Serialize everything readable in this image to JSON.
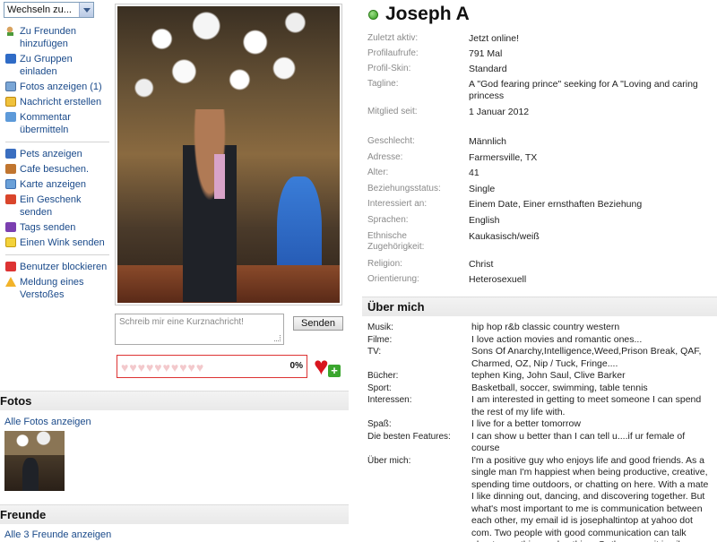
{
  "nav": {
    "select_value": "Wechseln zu..."
  },
  "actions": [
    {
      "label": "Zu Freunden hinzufügen",
      "icon": "add-friend-icon"
    },
    {
      "label": "Zu Gruppen einladen",
      "icon": "group-icon"
    },
    {
      "label": "Fotos anzeigen (1)",
      "icon": "photo-icon"
    },
    {
      "label": "Nachricht erstellen",
      "icon": "mail-icon"
    },
    {
      "label": "Kommentar übermitteln",
      "icon": "comment-icon"
    }
  ],
  "actions2": [
    {
      "label": "Pets anzeigen",
      "icon": "pets-icon"
    },
    {
      "label": "Cafe besuchen.",
      "icon": "cafe-icon"
    },
    {
      "label": "Karte anzeigen",
      "icon": "map-icon"
    },
    {
      "label": "Ein Geschenk senden",
      "icon": "gift-icon"
    },
    {
      "label": "Tags senden",
      "icon": "tag-icon"
    },
    {
      "label": "Einen Wink senden",
      "icon": "wink-icon"
    }
  ],
  "actions3": [
    {
      "label": "Benutzer blockieren",
      "icon": "block-icon"
    },
    {
      "label": "Meldung eines Verstoßes",
      "icon": "warning-icon"
    }
  ],
  "message": {
    "placeholder": "Schreib mir eine Kurznachricht!",
    "send_label": "Senden"
  },
  "hearts": {
    "percent": "0%",
    "glyphs": "♥♥♥♥♥♥♥♥♥♥"
  },
  "fotos": {
    "title": "Fotos",
    "link": "Alle Fotos anzeigen"
  },
  "freunde": {
    "title": "Freunde",
    "link": "Alle 3 Freunde anzeigen"
  },
  "profile": {
    "name": "Joseph A",
    "status_color": "#2e9a1a",
    "details": [
      {
        "k": "Zuletzt aktiv:",
        "v": "Jetzt online!"
      },
      {
        "k": "Profilaufrufe:",
        "v": "791 Mal"
      },
      {
        "k": "Profil-Skin:",
        "v": "Standard"
      },
      {
        "k": "Tagline:",
        "v": "A \"God fearing prince\" seeking for A \"Loving and caring princess"
      },
      {
        "k": "Mitglied seit:",
        "v": "1 Januar 2012"
      }
    ],
    "personal": [
      {
        "k": "Geschlecht:",
        "v": "Männlich"
      },
      {
        "k": "Adresse:",
        "v": "Farmersville, TX"
      },
      {
        "k": "Alter:",
        "v": "41"
      },
      {
        "k": "Beziehungsstatus:",
        "v": "Single"
      },
      {
        "k": "Interessiert an:",
        "v": "Einem Date, Einer ernsthaften Beziehung"
      },
      {
        "k": "Sprachen:",
        "v": "English"
      },
      {
        "k": "Ethnische Zugehörigkeit:",
        "v": "Kaukasisch/weiß"
      },
      {
        "k": "Religion:",
        "v": "Christ"
      },
      {
        "k": "Orientierung:",
        "v": "Heterosexuell"
      }
    ]
  },
  "about": {
    "title": "Über mich",
    "items": [
      {
        "k": "Musik:",
        "v": "hip hop r&b classic country western"
      },
      {
        "k": "Filme:",
        "v": "I love action movies and romantic ones..."
      },
      {
        "k": "TV:",
        "v": "Sons Of Anarchy,Intelligence,Weed,Prison Break, QAF, Charmed, OZ, Nip / Tuck, Fringe...."
      },
      {
        "k": "Bücher:",
        "v": "tephen King, John Saul, Clive Barker"
      },
      {
        "k": "Sport:",
        "v": "Basketball, soccer, swimming, table tennis"
      },
      {
        "k": "Interessen:",
        "v": "I am interested in getting to meet someone I can spend the rest of my life with."
      },
      {
        "k": "Spaß:",
        "v": "I live for a better tomorrow"
      },
      {
        "k": "Die besten Features:",
        "v": "I can show u better than I can tell u....if ur female of course"
      },
      {
        "k": "Über mich:",
        "v": "I'm a positive guy who enjoys life and good friends. As a single man I'm happiest when being productive, creative, spending time outdoors, or chatting on here. With a mate I like dinning out, dancing, and discovering together. But what's most important to me is communication between each other, my email id is josephaltintop at yahoo dot com. Two people with good communication can talk about everything and nothing. Or they can sit in silence"
      }
    ]
  }
}
